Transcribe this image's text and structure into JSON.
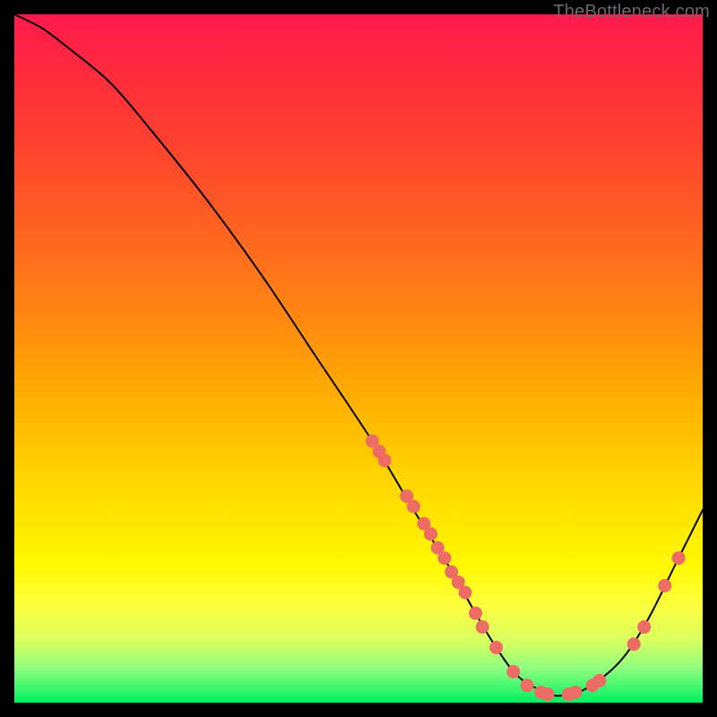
{
  "watermark": "TheBottleneck.com",
  "chart_data": {
    "type": "line",
    "title": "",
    "xlabel": "",
    "ylabel": "",
    "xlim": [
      0,
      100
    ],
    "ylim": [
      0,
      100
    ],
    "grid": false,
    "series": [
      {
        "name": "bottleneck-curve",
        "x": [
          0,
          4,
          8,
          14,
          20,
          28,
          36,
          44,
          52,
          58,
          63,
          67,
          70,
          73,
          76,
          79,
          83,
          88,
          92,
          96,
          100
        ],
        "y": [
          100,
          98,
          95,
          90,
          83,
          73,
          62,
          50,
          38,
          28,
          20,
          13,
          8,
          4,
          2,
          1,
          2,
          6,
          12,
          20,
          28
        ]
      }
    ],
    "scatter_points": {
      "name": "highlighted-points",
      "color": "#ed6c63",
      "points": [
        {
          "x": 52.0,
          "y": 38.0
        },
        {
          "x": 53.0,
          "y": 36.5
        },
        {
          "x": 53.8,
          "y": 35.2
        },
        {
          "x": 57.0,
          "y": 30.0
        },
        {
          "x": 58.0,
          "y": 28.5
        },
        {
          "x": 59.5,
          "y": 26.0
        },
        {
          "x": 60.5,
          "y": 24.5
        },
        {
          "x": 61.5,
          "y": 22.5
        },
        {
          "x": 62.5,
          "y": 21.0
        },
        {
          "x": 63.5,
          "y": 19.0
        },
        {
          "x": 64.5,
          "y": 17.5
        },
        {
          "x": 65.5,
          "y": 16.0
        },
        {
          "x": 67.0,
          "y": 13.0
        },
        {
          "x": 68.0,
          "y": 11.0
        },
        {
          "x": 70.0,
          "y": 8.0
        },
        {
          "x": 72.5,
          "y": 4.5
        },
        {
          "x": 74.5,
          "y": 2.5
        },
        {
          "x": 76.5,
          "y": 1.5
        },
        {
          "x": 77.5,
          "y": 1.2
        },
        {
          "x": 80.5,
          "y": 1.2
        },
        {
          "x": 81.5,
          "y": 1.5
        },
        {
          "x": 84.0,
          "y": 2.5
        },
        {
          "x": 85.0,
          "y": 3.2
        },
        {
          "x": 90.0,
          "y": 8.5
        },
        {
          "x": 91.5,
          "y": 11.0
        },
        {
          "x": 94.5,
          "y": 17.0
        },
        {
          "x": 96.5,
          "y": 21.0
        }
      ]
    }
  }
}
